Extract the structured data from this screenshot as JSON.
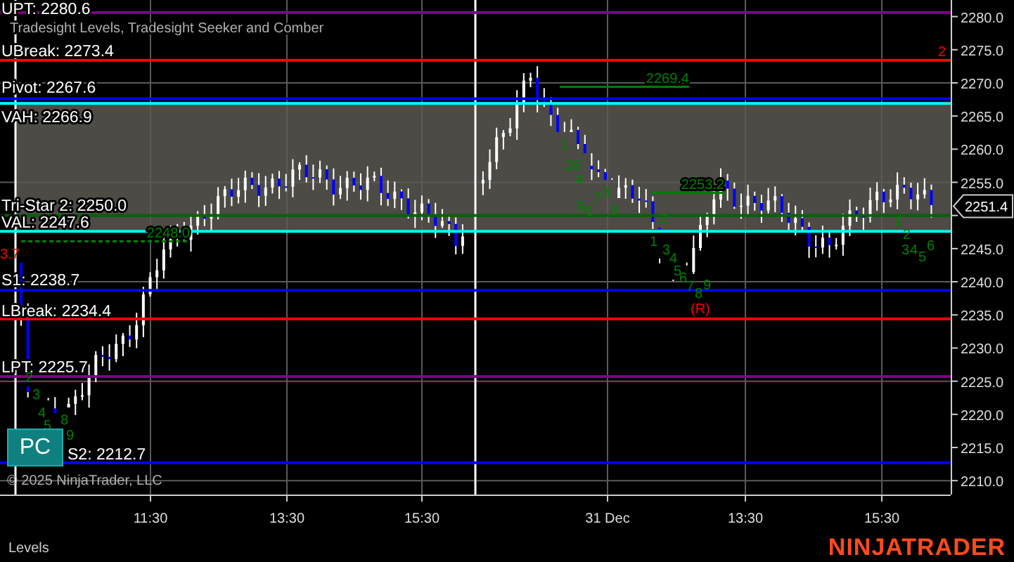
{
  "header": {
    "title": "Tradesight Levels, Tradesight Seeker and Comber"
  },
  "price_axis": [
    "2280.0",
    "2275.0",
    "2270.0",
    "2265.0",
    "2260.0",
    "2255.0",
    "2245.0",
    "2240.0",
    "2235.0",
    "2230.0",
    "2225.0",
    "2220.0",
    "2215.0",
    "2210.0"
  ],
  "last_price": "2251.4",
  "time_axis": [
    "11:30",
    "13:30",
    "15:30",
    "31 Dec",
    "13:30",
    "15:30"
  ],
  "levels": [
    {
      "label": "UPT: 2280.6",
      "color": "#800080"
    },
    {
      "label": "UBreak: 2273.4",
      "color": "#ff0000"
    },
    {
      "label": "Pivot: 2267.6",
      "color": "#0000ff"
    },
    {
      "label": "VAH: 2266.9",
      "color": "#00ffff"
    },
    {
      "label": "Tri-Star 2: 2250.0",
      "color": "#006400"
    },
    {
      "label": "VAL: 2247.6",
      "color": "#00ffff"
    },
    {
      "label": "S1: 2238.7",
      "color": "#0000ff"
    },
    {
      "label": "LBreak: 2234.4",
      "color": "#ff0000"
    },
    {
      "label": "LPT: 2225.7",
      "color": "#800080"
    },
    {
      "label": "S2: 2212.7",
      "color": "#0000ff"
    }
  ],
  "signals": [
    {
      "label": "2269.4",
      "dashed": false
    },
    {
      "label": "2253.2",
      "dashed": false
    },
    {
      "label": "2248.0",
      "dashed": true
    }
  ],
  "markers": [
    {
      "text": "3.7",
      "color": "#ff0000"
    },
    {
      "text": "(R)",
      "color": "#ff0000"
    },
    {
      "text": "2",
      "color": "#ff0000"
    },
    {
      "text": "2",
      "color": "#008000"
    },
    {
      "text": "3",
      "color": "#008000"
    },
    {
      "text": "4",
      "color": "#008000"
    },
    {
      "text": "5",
      "color": "#008000"
    },
    {
      "text": "8",
      "color": "#008000"
    },
    {
      "text": "9",
      "color": "#008000"
    },
    {
      "text": "1",
      "color": "#008000"
    },
    {
      "text": "28",
      "color": "#008000"
    },
    {
      "text": "4",
      "color": "#008000"
    },
    {
      "text": "5",
      "color": "#008000"
    },
    {
      "text": "6",
      "color": "#008000"
    },
    {
      "text": "7",
      "color": "#008000"
    },
    {
      "text": "8",
      "color": "#008000"
    },
    {
      "text": "9",
      "color": "#008000"
    },
    {
      "text": "1",
      "color": "#008000"
    },
    {
      "text": "2",
      "color": "#008000"
    },
    {
      "text": "3",
      "color": "#008000"
    },
    {
      "text": "4",
      "color": "#008000"
    },
    {
      "text": "5",
      "color": "#008000"
    },
    {
      "text": "6",
      "color": "#008000"
    },
    {
      "text": "7",
      "color": "#008000"
    },
    {
      "text": "8",
      "color": "#008000"
    },
    {
      "text": "9",
      "color": "#008000"
    },
    {
      "text": "1",
      "color": "#008000"
    },
    {
      "text": "2",
      "color": "#008000"
    },
    {
      "text": "3",
      "color": "#008000"
    },
    {
      "text": "4",
      "color": "#008000"
    },
    {
      "text": "5",
      "color": "#008000"
    },
    {
      "text": "6",
      "color": "#008000"
    }
  ],
  "pc_button": "PC",
  "copyright": "© 2025 NinjaTrader, LLC",
  "tab": "Levels",
  "logo": "NINJATRADER"
}
